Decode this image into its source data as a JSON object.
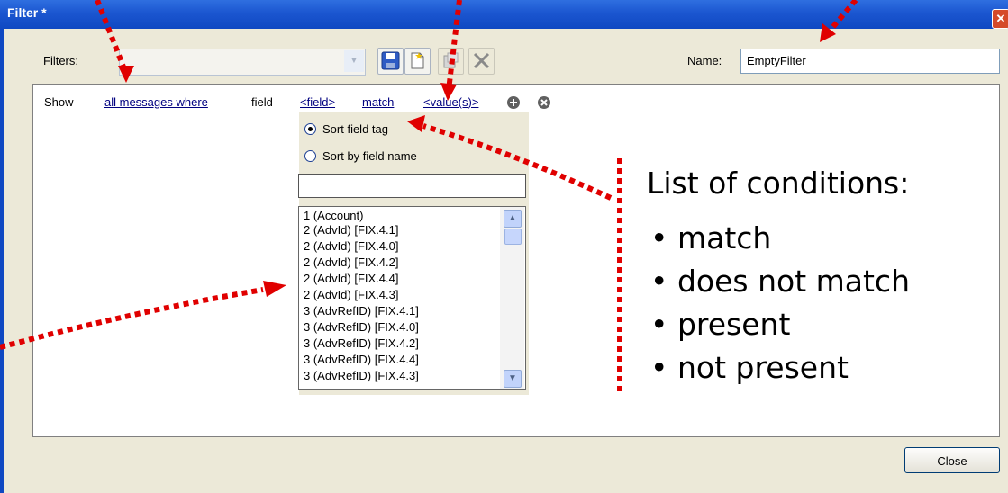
{
  "window": {
    "title": "Filter *"
  },
  "toolbar": {
    "filters_label": "Filters:",
    "name_label": "Name:",
    "name_value": "EmptyFilter"
  },
  "criteria": {
    "show": "Show",
    "scope": "all messages where",
    "field_word": "field",
    "field_placeholder": "<field>",
    "operator": "match",
    "value_placeholder": "<value(s)>"
  },
  "field_picker": {
    "sort_by_tag": "Sort field tag",
    "sort_by_name": "Sort by field name",
    "search_value": "",
    "items": [
      "1 (Account)",
      "2 (AdvId) [FIX.4.1]",
      "2 (AdvId) [FIX.4.0]",
      "2 (AdvId) [FIX.4.2]",
      "2 (AdvId) [FIX.4.4]",
      "2 (AdvId) [FIX.4.3]",
      "3 (AdvRefID) [FIX.4.1]",
      "3 (AdvRefID) [FIX.4.0]",
      "3 (AdvRefID) [FIX.4.2]",
      "3 (AdvRefID) [FIX.4.4]",
      "3 (AdvRefID) [FIX.4.3]"
    ]
  },
  "footer": {
    "close_label": "Close"
  },
  "callout": {
    "title": "List of conditions:",
    "items": [
      "match",
      "does not match",
      "present",
      "not present"
    ]
  },
  "colors": {
    "title_bar": "#0f48c2",
    "link": "#000080",
    "annotation": "#e00000"
  }
}
